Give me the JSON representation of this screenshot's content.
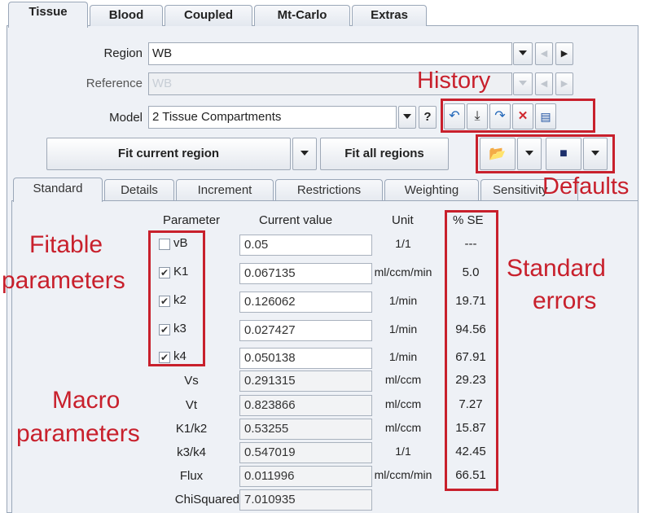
{
  "main_tabs": [
    "Tissue",
    "Blood",
    "Coupled",
    "Mt-Carlo",
    "Extras"
  ],
  "region": {
    "label": "Region",
    "value": "WB"
  },
  "reference": {
    "label": "Reference",
    "value": "WB"
  },
  "model": {
    "label": "Model",
    "value": "2 Tissue Compartments",
    "help": "?"
  },
  "fit_buttons": {
    "current": "Fit current region",
    "all": "Fit all regions"
  },
  "sub_tabs": [
    "Standard",
    "Details",
    "Increment",
    "Restrictions",
    "Weighting",
    "Sensitivity"
  ],
  "headers": {
    "parameter": "Parameter",
    "value": "Current value",
    "unit": "Unit",
    "se": "% SE"
  },
  "fit_params": [
    {
      "name": "vB",
      "checked": false,
      "value": "0.05",
      "unit": "1/1",
      "se": "---"
    },
    {
      "name": "K1",
      "checked": true,
      "value": "0.067135",
      "unit": "ml/ccm/min",
      "se": "5.0"
    },
    {
      "name": "k2",
      "checked": true,
      "value": "0.126062",
      "unit": "1/min",
      "se": "19.71"
    },
    {
      "name": "k3",
      "checked": true,
      "value": "0.027427",
      "unit": "1/min",
      "se": "94.56"
    },
    {
      "name": "k4",
      "checked": true,
      "value": "0.050138",
      "unit": "1/min",
      "se": "67.91"
    }
  ],
  "macro_params": [
    {
      "name": "Vs",
      "value": "0.291315",
      "unit": "ml/ccm",
      "se": "29.23"
    },
    {
      "name": "Vt",
      "value": "0.823866",
      "unit": "ml/ccm",
      "se": "7.27"
    },
    {
      "name": "K1/k2",
      "value": "0.53255",
      "unit": "ml/ccm",
      "se": "15.87"
    },
    {
      "name": "k3/k4",
      "value": "0.547019",
      "unit": "1/1",
      "se": "42.45"
    },
    {
      "name": "Flux",
      "value": "0.011996",
      "unit": "ml/ccm/min",
      "se": "66.51"
    },
    {
      "name": "ChiSquared",
      "value": "7.010935",
      "unit": "",
      "se": ""
    }
  ],
  "annotations": {
    "history": "History",
    "defaults": "Defaults",
    "fitable_line1": "Fitable",
    "fitable_line2": "parameters",
    "macro_line1": "Macro",
    "macro_line2": "parameters",
    "standard_line1": "Standard",
    "standard_line2": "errors"
  },
  "colors": {
    "annotation_red": "#c8202c",
    "panel_bg": "#eef1f6"
  },
  "icons": {
    "undo": "undo-icon",
    "download": "download-icon",
    "redo": "redo-icon",
    "delete": "delete-icon",
    "clipboard": "clipboard-icon",
    "open": "folder-open-icon",
    "save": "floppy-disk-icon"
  }
}
